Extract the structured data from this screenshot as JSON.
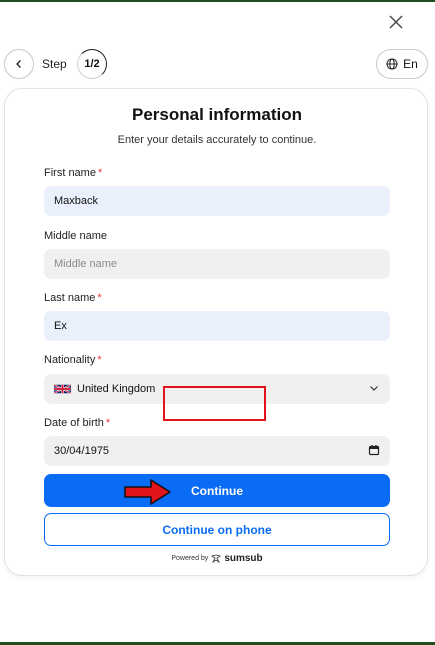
{
  "header": {
    "step_label": "Step",
    "step_counter": "1/2",
    "language": "En"
  },
  "form": {
    "title": "Personal information",
    "subtitle": "Enter your details accurately to continue.",
    "first_name": {
      "label": "First name",
      "required": "*",
      "value": "Maxback"
    },
    "middle_name": {
      "label": "Middle name",
      "placeholder": "Middle name",
      "value": ""
    },
    "last_name": {
      "label": "Last name",
      "required": "*",
      "value": "Ex"
    },
    "nationality": {
      "label": "Nationality",
      "required": "*",
      "value": "United Kingdom",
      "flag": "uk-flag-icon"
    },
    "date_of_birth": {
      "label": "Date of birth",
      "required": "*",
      "value": "30/04/1975"
    }
  },
  "actions": {
    "continue_label": "Continue",
    "continue_phone_label": "Continue on phone"
  },
  "footer": {
    "powered_by": "Powered by",
    "brand": "sumsub"
  },
  "colors": {
    "accent": "#0a6cf5",
    "highlight": "#e0141a",
    "required": "#e53935",
    "filled_field": "#eaf0fb"
  }
}
